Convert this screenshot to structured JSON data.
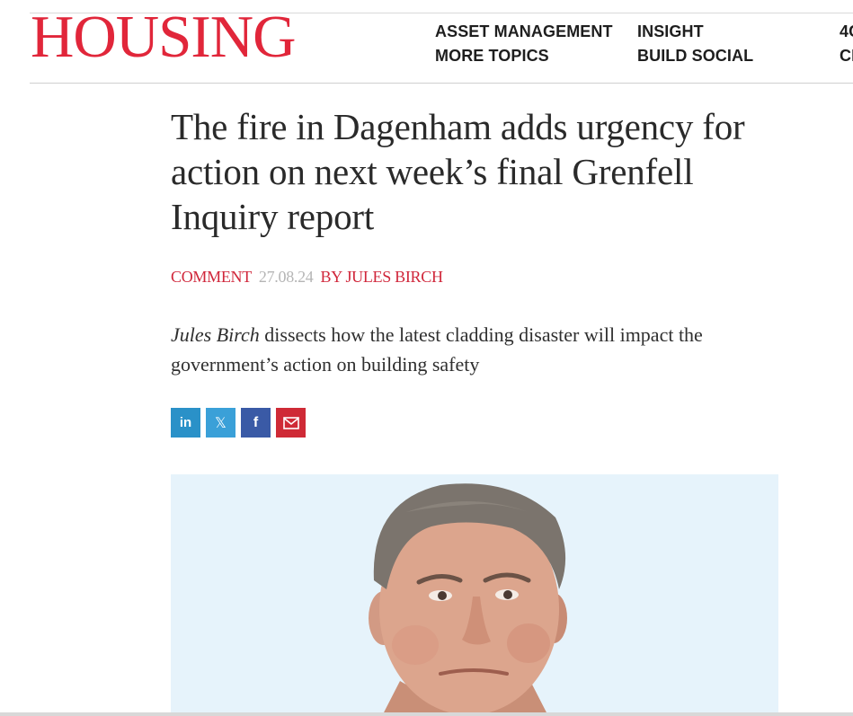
{
  "brand": {
    "logo_text": "HOUSING",
    "accent_color": "#e1263a"
  },
  "nav": {
    "items": [
      {
        "label": "ASSET MANAGEMENT"
      },
      {
        "label": "MORE TOPICS"
      },
      {
        "label": "INSIGHT"
      },
      {
        "label": "BUILD SOCIAL"
      },
      {
        "label": "4C"
      },
      {
        "label": "CI"
      }
    ]
  },
  "article": {
    "headline": "The fire in Dagenham adds urgency for action on next week’s final Grenfell Inquiry report",
    "category": "COMMENT",
    "date": "27.08.24",
    "byline": "BY JULES BIRCH",
    "standfirst_author": "Jules Birch",
    "standfirst_rest": " dissects how the latest cladding disaster will impact the government’s action on building safety"
  },
  "share": {
    "buttons": [
      {
        "icon": "linkedin-icon",
        "glyph": "in",
        "color": "#2a91c8"
      },
      {
        "icon": "x-twitter-icon",
        "glyph": "𝕏",
        "color": "#3aa0d8"
      },
      {
        "icon": "facebook-icon",
        "glyph": "f",
        "color": "#3a5aa6"
      },
      {
        "icon": "email-icon",
        "glyph": "",
        "color": "#cf2a36"
      }
    ]
  },
  "hero": {
    "background_color": "#e6f3fb",
    "subject": "portrait-photo"
  }
}
